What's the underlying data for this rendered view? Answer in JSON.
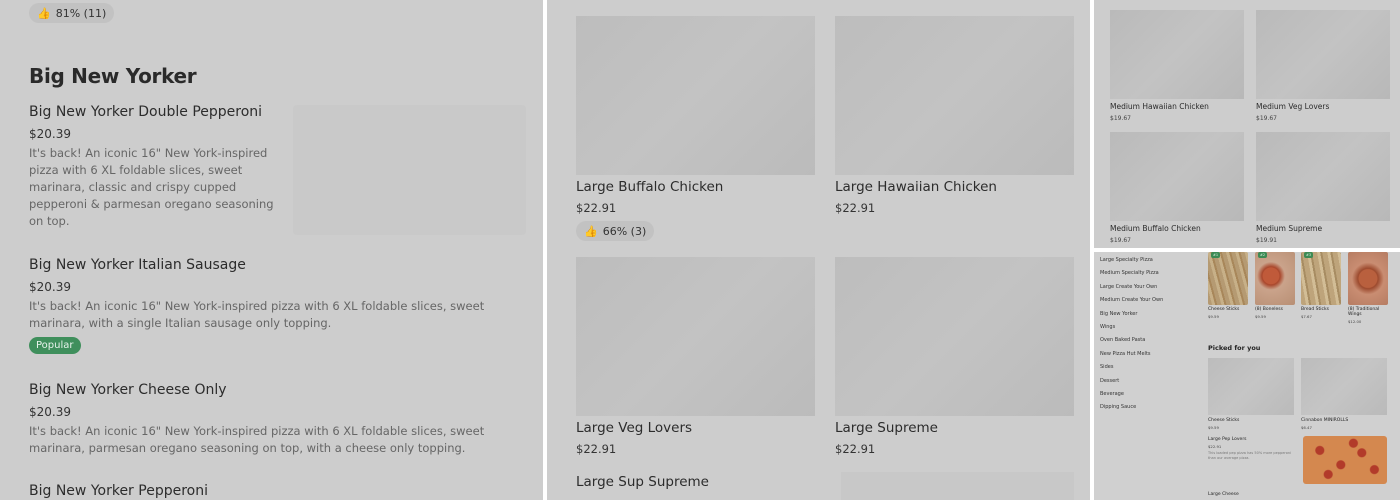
{
  "panel1": {
    "rating": "81% (11)",
    "section_title": "Big New Yorker",
    "items": [
      {
        "name": "Big New Yorker Double Pepperoni",
        "price": "$20.39",
        "desc": "It's back! An iconic 16\" New York-inspired pizza with 6 XL foldable slices, sweet marinara, classic and crispy cupped pepperoni & parmesan oregano seasoning on top."
      },
      {
        "name": "Big New Yorker Italian Sausage",
        "price": "$20.39",
        "desc": "It's back! An iconic 16\" New York-inspired pizza with 6 XL foldable slices, sweet marinara, with a single Italian sausage only topping.",
        "badge": "Popular"
      },
      {
        "name": "Big New Yorker Cheese Only",
        "price": "$20.39",
        "desc": "It's back! An iconic 16\" New York-inspired pizza with 6 XL foldable slices, sweet marinara, parmesan oregano seasoning on top, with a cheese only topping."
      },
      {
        "name": "Big New Yorker Pepperoni"
      }
    ]
  },
  "panel2": {
    "cards": [
      {
        "name": "Large Buffalo Chicken",
        "price": "$22.91",
        "rating": "66% (3)"
      },
      {
        "name": "Large Hawaiian Chicken",
        "price": "$22.91"
      },
      {
        "name": "Large Veg Lovers",
        "price": "$22.91"
      },
      {
        "name": "Large Supreme",
        "price": "$22.91"
      },
      {
        "name": "Large Sup Supreme"
      }
    ]
  },
  "panel3": {
    "cards": [
      {
        "name": "Medium Hawaiian Chicken",
        "price": "$19.67"
      },
      {
        "name": "Medium Veg Lovers",
        "price": "$19.67"
      },
      {
        "name": "Medium Buffalo Chicken",
        "price": "$19.67"
      },
      {
        "name": "Medium Supreme",
        "price": "$19.91"
      }
    ]
  },
  "panel4": {
    "nav": [
      "Large Specialty Pizza",
      "Medium Specialty Pizza",
      "Large Create Your Own",
      "Medium Create Your Own",
      "Big New Yorker",
      "Wings",
      "Oven Baked Pasta",
      "New Pizza Hut Melts",
      "Sides",
      "Dessert",
      "Beverage",
      "Dipping Sauce"
    ],
    "minis": [
      {
        "name": "Cheese Sticks",
        "price": "$9.59",
        "tag": "#1"
      },
      {
        "name": "(8) Boneless",
        "price": "$9.59",
        "tag": "#2"
      },
      {
        "name": "Bread Sticks",
        "price": "$7.67",
        "tag": "#3"
      },
      {
        "name": "(8) Traditional Wings",
        "price": "$12.00",
        "tag": ""
      }
    ],
    "picked_title": "Picked for you",
    "picked": [
      {
        "name": "Cheese Sticks",
        "price": "$9.59"
      },
      {
        "name": "Cinnabon MINIROLLS",
        "price": "$6.47"
      }
    ],
    "pep": {
      "name": "Large Pep Lovers",
      "price": "$22.91",
      "desc": "This loaded pep pizza has 50% more pepperoni than our average pizza."
    },
    "next": "Large Cheese"
  }
}
